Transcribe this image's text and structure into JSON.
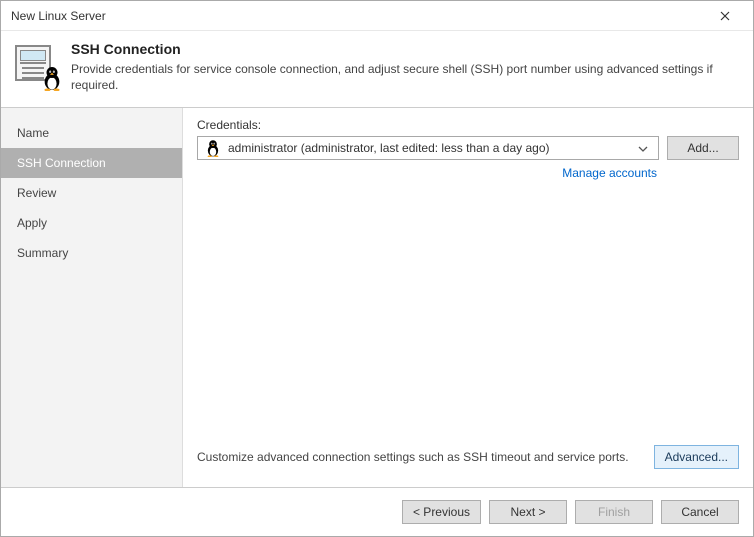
{
  "window": {
    "title": "New Linux Server"
  },
  "header": {
    "title": "SSH Connection",
    "description": "Provide credentials for service console connection, and adjust secure shell (SSH) port number using advanced settings if required."
  },
  "sidebar": {
    "items": [
      {
        "label": "Name"
      },
      {
        "label": "SSH Connection"
      },
      {
        "label": "Review"
      },
      {
        "label": "Apply"
      },
      {
        "label": "Summary"
      }
    ],
    "active_index": 1
  },
  "content": {
    "credentials_label": "Credentials:",
    "selected_credential": "administrator (administrator, last edited: less than a day ago)",
    "add_button": "Add...",
    "manage_link": "Manage accounts",
    "advanced_hint": "Customize advanced connection settings such as SSH timeout and service ports.",
    "advanced_button": "Advanced..."
  },
  "footer": {
    "previous": "< Previous",
    "next": "Next >",
    "finish": "Finish",
    "cancel": "Cancel"
  }
}
